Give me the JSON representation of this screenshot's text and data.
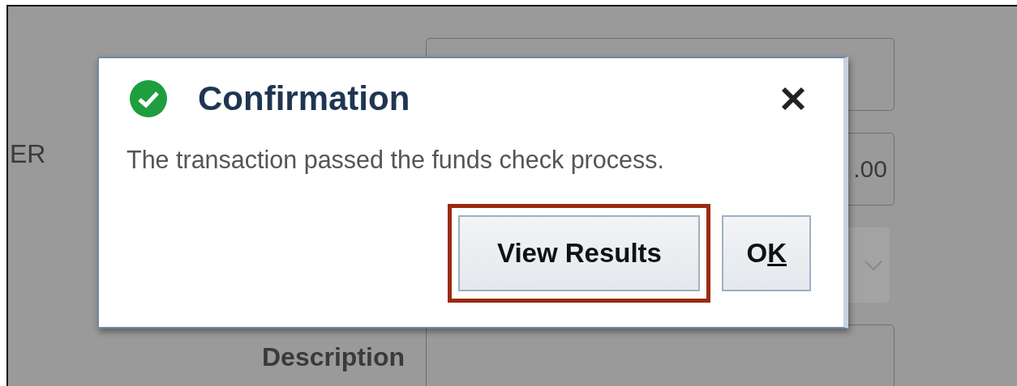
{
  "form": {
    "rows": [
      {
        "label": "",
        "value": "",
        "kind": "text"
      },
      {
        "label": "ER",
        "value": ".00",
        "kind": "text"
      },
      {
        "label": "",
        "value": "",
        "kind": "dropdown",
        "disabled": true
      },
      {
        "label": "Description",
        "value": "",
        "kind": "text"
      }
    ]
  },
  "dialog": {
    "title": "Confirmation",
    "kind": "success",
    "message": "The transaction passed the funds check process.",
    "buttons": [
      {
        "label": "View Results",
        "highlighted": true
      },
      {
        "label": "O",
        "mnemonic": "K",
        "highlighted": false
      }
    ]
  }
}
